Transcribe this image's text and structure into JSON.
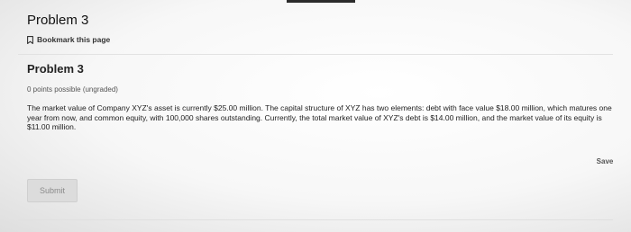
{
  "unit": {
    "title": "Problem 3",
    "bookmark_label": "Bookmark this page",
    "bookmark_icon": "bookmark-icon"
  },
  "problem": {
    "title": "Problem 3",
    "points": "0 points possible (ungraded)",
    "text": "The market value of Company XYZ's asset is currently $25.00 million. The capital structure of XYZ has two elements: debt with face value $18.00 million, which matures one year from now, and common equity, with 100,000 shares outstanding. Currently, the total market value of XYZ's debt is $14.00 million, and the market value of its equity is $11.00 million."
  },
  "actions": {
    "save_label": "Save",
    "submit_label": "Submit"
  }
}
